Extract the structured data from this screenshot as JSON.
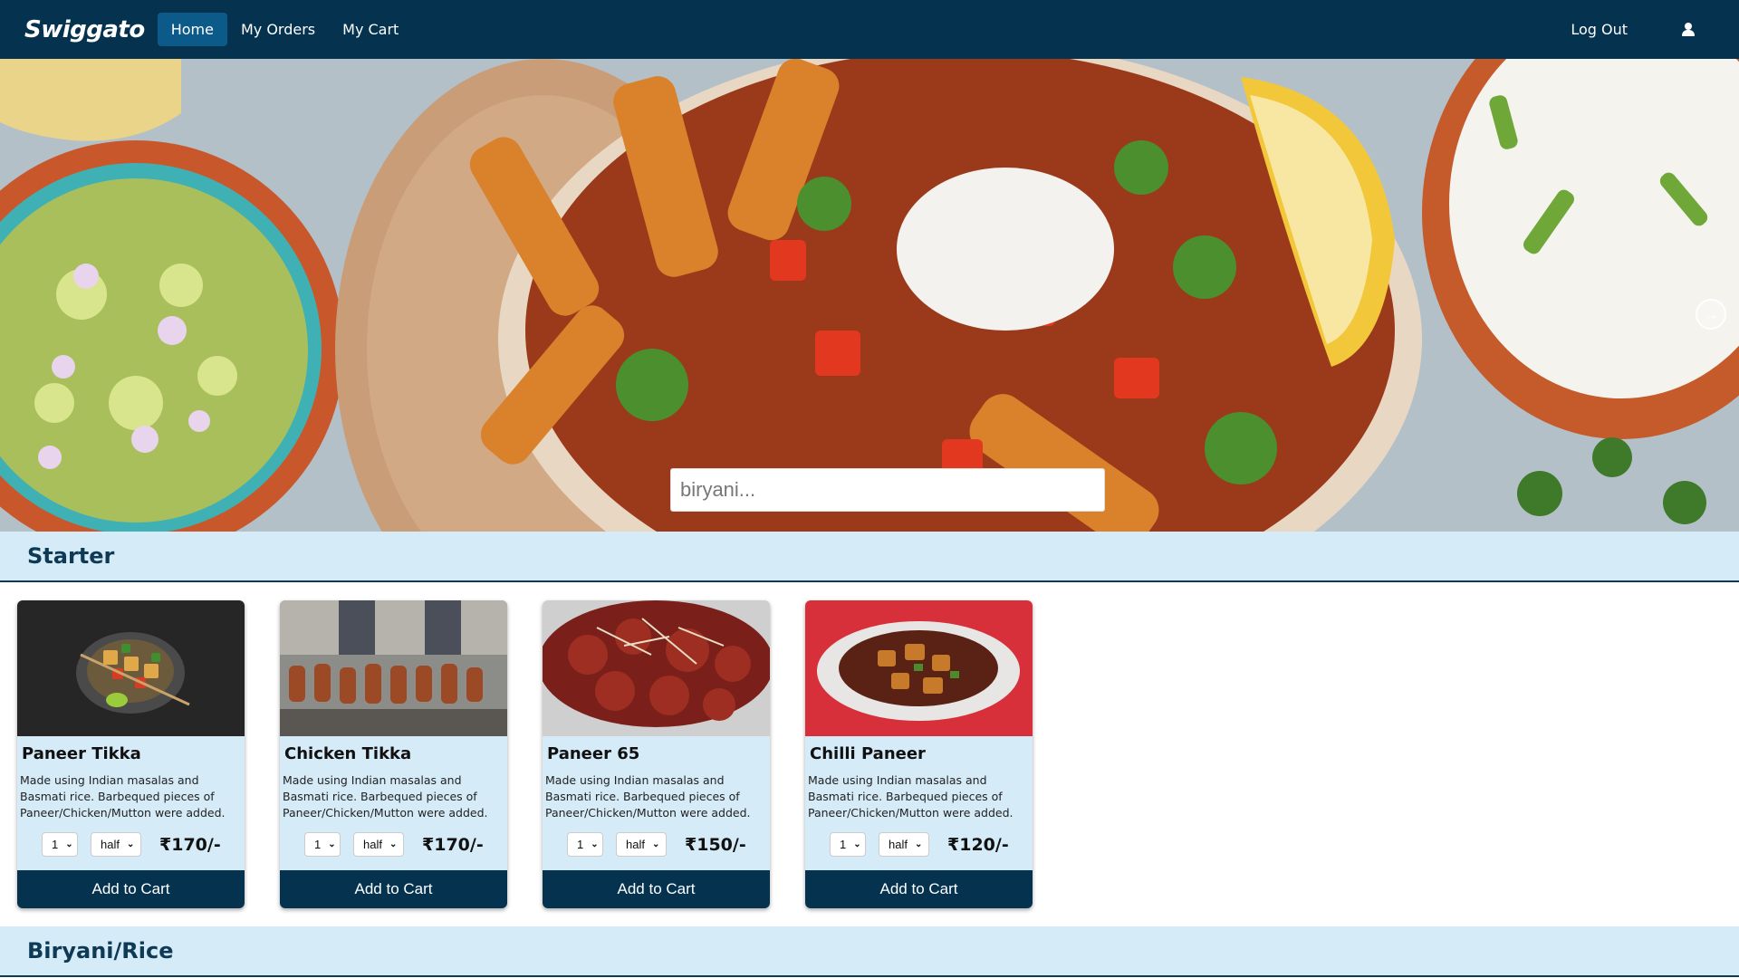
{
  "navbar": {
    "brand": "Swiggato",
    "items": [
      {
        "label": "Home",
        "active": true
      },
      {
        "label": "My Orders",
        "active": false
      },
      {
        "label": "My Cart",
        "active": false
      }
    ],
    "logout": "Log Out",
    "user_icon": "user-icon"
  },
  "hero": {
    "search_placeholder": "biryani...",
    "next_icon": "arrow-right-icon"
  },
  "sections": [
    {
      "title": "Starter"
    },
    {
      "title": "Biryani/Rice"
    }
  ],
  "cards": [
    {
      "title": "Paneer Tikka",
      "description": "Made using Indian masalas and Basmati rice. Barbequed pieces of Paneer/Chicken/Mutton were added.",
      "qty": "1",
      "size": "half",
      "price": "₹170/-",
      "button": "Add to Cart"
    },
    {
      "title": "Chicken Tikka",
      "description": "Made using Indian masalas and Basmati rice. Barbequed pieces of Paneer/Chicken/Mutton were added.",
      "qty": "1",
      "size": "half",
      "price": "₹170/-",
      "button": "Add to Cart"
    },
    {
      "title": "Paneer 65",
      "description": "Made using Indian masalas and Basmati rice. Barbequed pieces of Paneer/Chicken/Mutton were added.",
      "qty": "1",
      "size": "half",
      "price": "₹150/-",
      "button": "Add to Cart"
    },
    {
      "title": "Chilli Paneer",
      "description": "Made using Indian masalas and Basmati rice. Barbequed pieces of Paneer/Chicken/Mutton were added.",
      "qty": "1",
      "size": "half",
      "price": "₹120/-",
      "button": "Add to Cart"
    }
  ],
  "colors": {
    "navbar": "#04324f",
    "active_nav": "#0c5a89",
    "section_bg": "#d5ebf8",
    "button": "#04324f"
  }
}
